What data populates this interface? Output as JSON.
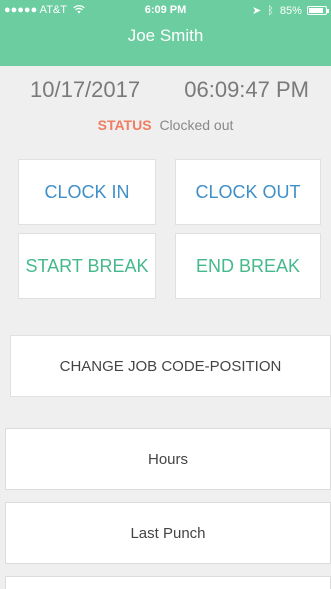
{
  "status_bar": {
    "carrier": "●●●●● AT&T",
    "time": "6:09 PM",
    "battery": "85%",
    "battery_level": 0.85
  },
  "header": {
    "title": "Joe Smith"
  },
  "clock": {
    "date": "10/17/2017",
    "time": "06:09:47 PM"
  },
  "status": {
    "label": "STATUS",
    "value": "Clocked out"
  },
  "buttons": {
    "clock_in": "CLOCK IN",
    "clock_out": "CLOCK OUT",
    "start_break": "START BREAK",
    "end_break": "END BREAK"
  },
  "change_job": {
    "label": "CHANGE JOB CODE-POSITION"
  },
  "list": {
    "hours": "Hours",
    "last_punch": "Last Punch"
  },
  "colors": {
    "header": "#6ccea0",
    "blue_button": "#3f8fc8",
    "green_button": "#45b98c",
    "status_label": "#ef7e62"
  }
}
